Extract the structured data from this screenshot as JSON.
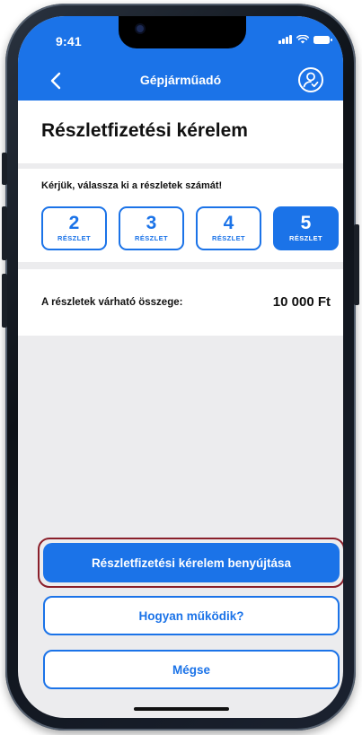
{
  "status_bar": {
    "time": "9:41"
  },
  "nav": {
    "title": "Gépjárműadó"
  },
  "page": {
    "title": "Részletfizetési kérelem"
  },
  "installments": {
    "prompt": "Kérjük, válassza ki a részletek számát!",
    "options": [
      {
        "number": "2",
        "label": "RÉSZLET",
        "selected": false
      },
      {
        "number": "3",
        "label": "RÉSZLET",
        "selected": false
      },
      {
        "number": "4",
        "label": "RÉSZLET",
        "selected": false
      },
      {
        "number": "5",
        "label": "RÉSZLET",
        "selected": true
      }
    ]
  },
  "amount": {
    "label": "A részletek várható összege:",
    "value": "10 000 Ft"
  },
  "buttons": {
    "submit": "Részletfizetési kérelem benyújtása",
    "how_it_works": "Hogyan működik?",
    "cancel": "Mégse"
  },
  "colors": {
    "accent": "#1b73e8",
    "highlight_border": "#8a1f2a",
    "background": "#ececee"
  }
}
